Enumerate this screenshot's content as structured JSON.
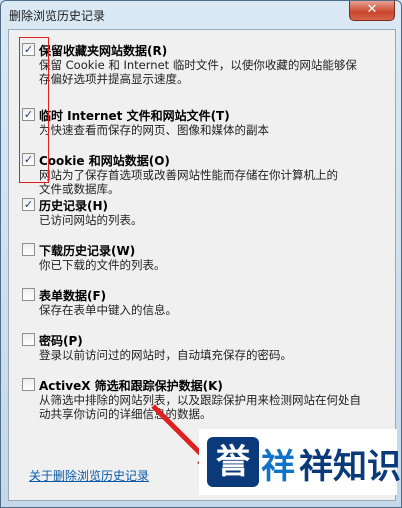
{
  "window": {
    "title": "删除浏览历史记录",
    "close_glyph": "✕"
  },
  "items": [
    {
      "label": "保留收藏夹网站数据(R)",
      "checked": true,
      "desc": [
        "保留 Cookie 和 Internet 临时文件，以使你收藏的网站能够保",
        "存偏好选项并提高显示速度。"
      ]
    },
    {
      "label": "临时 Internet 文件和网站文件(T)",
      "checked": true,
      "desc": [
        "为快速查看而保存的网页、图像和媒体的副本"
      ]
    },
    {
      "label": "Cookie 和网站数据(O)",
      "checked": true,
      "desc": [
        "网站为了保存首选项或改善网站性能而存储在你计算机上的",
        "文件或数据库。"
      ]
    },
    {
      "label": "历史记录(H)",
      "checked": true,
      "desc": [
        "已访问网站的列表。"
      ]
    },
    {
      "label": "下载历史记录(W)",
      "checked": false,
      "desc": [
        "你已下载的文件的列表。"
      ]
    },
    {
      "label": "表单数据(F)",
      "checked": false,
      "desc": [
        "保存在表单中键入的信息。"
      ]
    },
    {
      "label": "密码(P)",
      "checked": false,
      "desc": [
        "登录以前访问过的网站时，自动填充保存的密码。"
      ]
    },
    {
      "label": "ActiveX 筛选和跟踪保护数据(K)",
      "checked": false,
      "desc": [
        "从筛选中排除的网站列表，以及跟踪保护用来检测网站在何处自",
        "动共享你访问的详细信息的数据。"
      ]
    }
  ],
  "about_link": "关于删除浏览历史记录",
  "watermark": {
    "box": "誉",
    "mid": "祥",
    "text": "祥知识"
  },
  "colors": {
    "accent": "#0a5aa8",
    "annotation": "#e02020"
  }
}
